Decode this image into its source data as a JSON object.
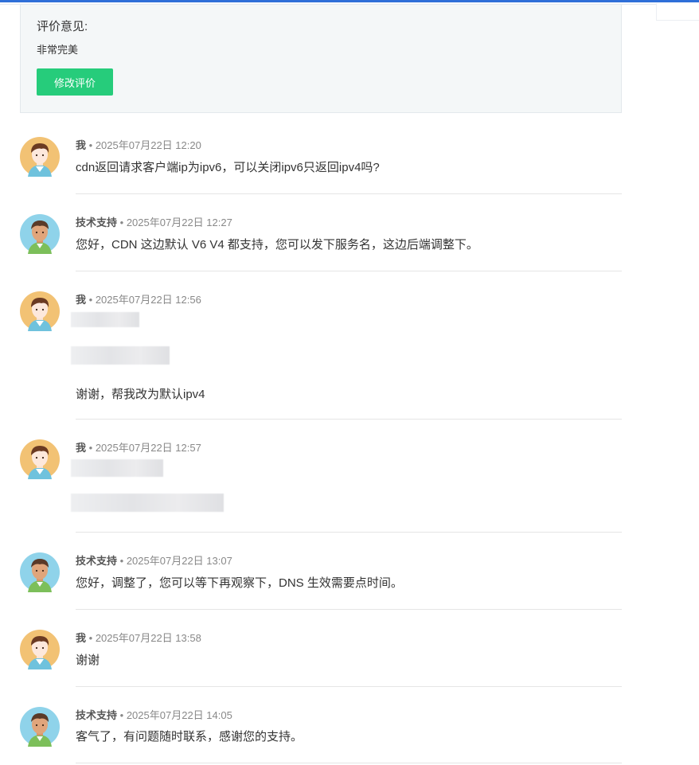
{
  "review": {
    "label": "评价意见:",
    "text": "非常完美",
    "edit_button": "修改评价"
  },
  "messages": [
    {
      "author": "我",
      "time": "2025年07月22日 12:20",
      "role": "user",
      "lines": [
        "cdn返回请求客户端ip为ipv6，可以关闭ipv6只返回ipv4吗?"
      ]
    },
    {
      "author": "技术支持",
      "time": "2025年07月22日 12:27",
      "role": "support",
      "lines": [
        "您好，CDN 这边默认 V6 V4 都支持，您可以发下服务名，这边后端调整下。"
      ]
    },
    {
      "author": "我",
      "time": "2025年07月22日 12:56",
      "role": "user",
      "lines": [
        "谢谢，帮我改为默认ipv4"
      ]
    },
    {
      "author": "我",
      "time": "2025年07月22日 12:57",
      "role": "user",
      "lines": []
    },
    {
      "author": "技术支持",
      "time": "2025年07月22日 13:07",
      "role": "support",
      "lines": [
        "您好，调整了，您可以等下再观察下，DNS 生效需要点时间。"
      ]
    },
    {
      "author": "我",
      "time": "2025年07月22日 13:58",
      "role": "user",
      "lines": [
        "谢谢"
      ]
    },
    {
      "author": "技术支持",
      "time": "2025年07月22日 14:05",
      "role": "support",
      "lines": [
        "客气了，有问题随时联系，感谢您的支持。"
      ]
    }
  ],
  "separator": "•",
  "colors": {
    "accent_bar": "#2f6fd8",
    "button": "#26cc7b",
    "user_avatar_bg": "#f2c274",
    "support_avatar_bg": "#8fd3ea"
  }
}
